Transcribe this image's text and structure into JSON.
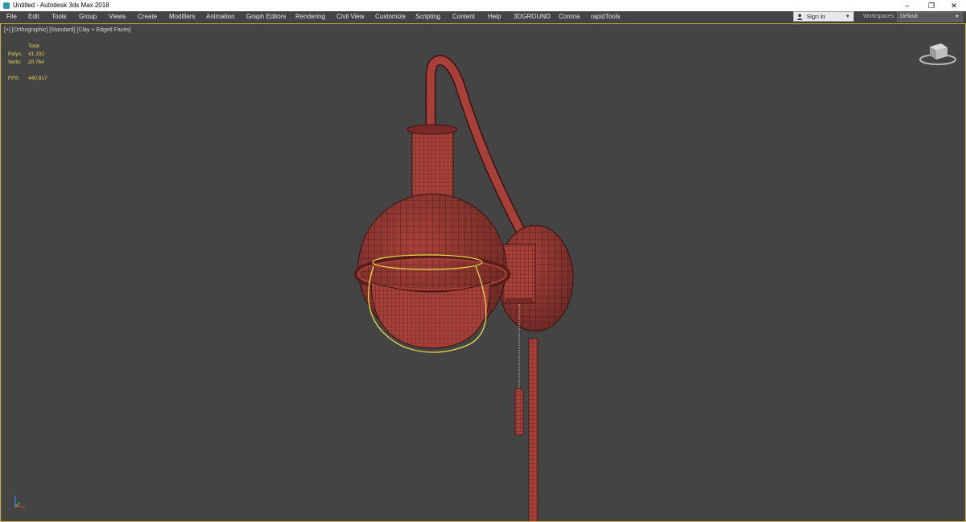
{
  "window": {
    "title": "Untitled - Autodesk 3ds Max 2018",
    "minimize_glyph": "–",
    "restore_glyph": "❐",
    "close_glyph": "✕"
  },
  "menu": {
    "items": [
      "File",
      "Edit",
      "Tools",
      "Group",
      "Views",
      "Create",
      "Modifiers",
      "Animation",
      "Graph Editors",
      "Rendering",
      "Civil View",
      "Customize",
      "Scripting",
      "Content",
      "Help",
      "3DGROUND",
      "Corona",
      "rapidTools"
    ]
  },
  "account": {
    "signin_label": "Sign In",
    "workspaces_label": "Workspaces:",
    "workspace_value": "Default"
  },
  "viewport": {
    "label": "[+] [Orthographic] [Standard] [Clay + Edged Faces]",
    "stats": {
      "header": "Total",
      "polys_label": "Polys:",
      "polys_value": "41 292",
      "verts_label": "Verts:",
      "verts_value": "20 764",
      "fps_label": "FPS:",
      "fps_value": "440,917"
    }
  },
  "colors": {
    "background": "#444444",
    "mesh_fill": "#a8403a",
    "mesh_wire": "#3a1512",
    "selection": "#e8d84a",
    "viewport_border": "#c9b54a"
  },
  "icons": [
    "app-icon",
    "user-icon",
    "viewcube-icon",
    "axis-gizmo-icon"
  ]
}
